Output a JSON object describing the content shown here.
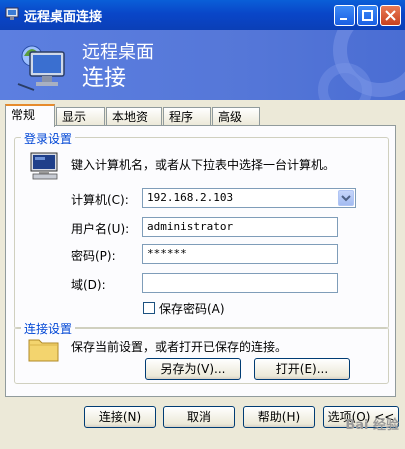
{
  "window": {
    "title": "远程桌面连接"
  },
  "banner": {
    "line1": "远程桌面",
    "line2": "连接"
  },
  "tabs": [
    {
      "label": "常规",
      "active": true
    },
    {
      "label": "显示"
    },
    {
      "label": "本地资源"
    },
    {
      "label": "程序"
    },
    {
      "label": "高级"
    }
  ],
  "login": {
    "title": "登录设置",
    "instruction": "键入计算机名，或者从下拉表中选择一台计算机。",
    "computer_label": "计算机(C):",
    "computer_value": "192.168.2.103",
    "username_label": "用户名(U):",
    "username_value": "administrator",
    "password_label": "密码(P):",
    "password_value": "******",
    "domain_label": "域(D):",
    "domain_value": "",
    "save_password_label": "保存密码(A)",
    "save_password_checked": false
  },
  "connection": {
    "title": "连接设置",
    "instruction": "保存当前设置，或者打开已保存的连接。",
    "save_as_label": "另存为(V)...",
    "open_label": "打开(E)..."
  },
  "footer": {
    "connect_label": "连接(N)",
    "cancel_label": "取消",
    "help_label": "帮助(H)",
    "options_label": "选项(O) <<"
  },
  "watermark": "Bai 经验"
}
